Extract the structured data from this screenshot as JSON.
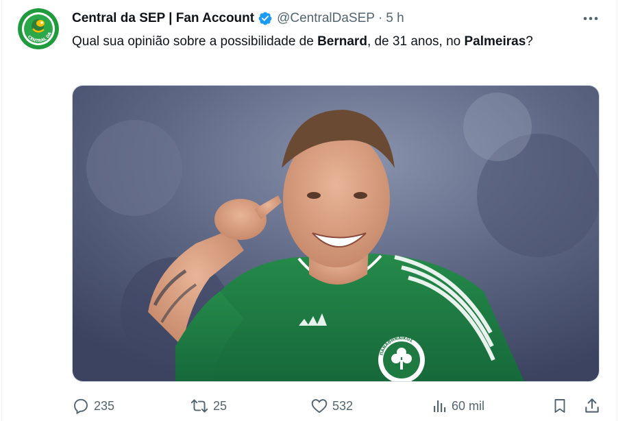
{
  "tweet": {
    "author": {
      "display_name": "Central da SEP | Fan Account",
      "handle": "@CentralDaSEP",
      "verified": true,
      "avatar_text": "CENTRAL DA SEP"
    },
    "separator": "·",
    "time": "5 h",
    "text": {
      "part1": "Qual sua opinião sobre a possibilidade de ",
      "bold1": "Bernard",
      "part2": ", de 31 anos, no ",
      "bold2": "Palmeiras",
      "part3": "?"
    },
    "media": {
      "alt": "Bernard sorrindo e apontando, com camisa verde",
      "crest_text": "ΠΑΝΑΘΗΝΑΪΚΟΣ"
    },
    "actions": {
      "replies": "235",
      "retweets": "25",
      "likes": "532",
      "views": "60 mil"
    }
  },
  "icons": {
    "verified": "verified-badge-icon",
    "more": "more-dots-icon",
    "reply": "reply-icon",
    "retweet": "retweet-icon",
    "like": "heart-icon",
    "views": "analytics-icon",
    "bookmark": "bookmark-icon",
    "share": "share-icon"
  },
  "colors": {
    "verified": "#1d9bf0",
    "text": "#0f1419",
    "secondary": "#536471",
    "avatar_green": "#1f9a3c",
    "jersey_green": "#1f7a42"
  }
}
